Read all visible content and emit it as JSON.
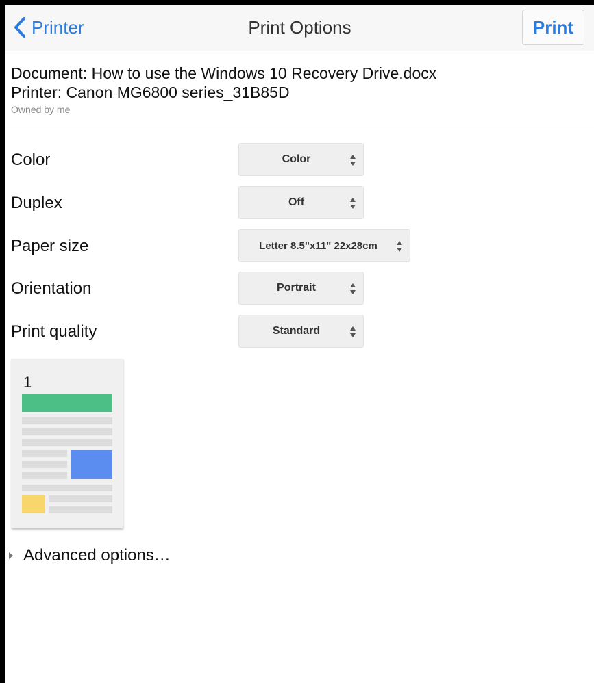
{
  "navbar": {
    "back_label": "Printer",
    "title": "Print Options",
    "print_label": "Print"
  },
  "document": {
    "line1": "Document: How to use the Windows 10 Recovery Drive.docx",
    "line2": "Printer: Canon MG6800 series_31B85D",
    "owner": "Owned by me"
  },
  "options": [
    {
      "label": "Color",
      "value": "Color"
    },
    {
      "label": "Duplex",
      "value": "Off"
    },
    {
      "label": "Paper size",
      "value": "Letter 8.5\"x11\" 22x28cm"
    },
    {
      "label": "Orientation",
      "value": "Portrait"
    },
    {
      "label": "Print quality",
      "value": "Standard"
    }
  ],
  "preview": {
    "page_number": "1"
  },
  "advanced": {
    "label": "Advanced options…"
  },
  "colors": {
    "accent": "#2c7ce0",
    "thumb_green": "#4cbf86",
    "thumb_blue": "#5b8df0",
    "thumb_yellow": "#f9d66c",
    "thumb_gray": "#dcdcdc"
  },
  "icons": {
    "back": "chevron-left-icon",
    "select": "up-down-arrows-icon",
    "disclosure": "triangle-right-icon"
  }
}
